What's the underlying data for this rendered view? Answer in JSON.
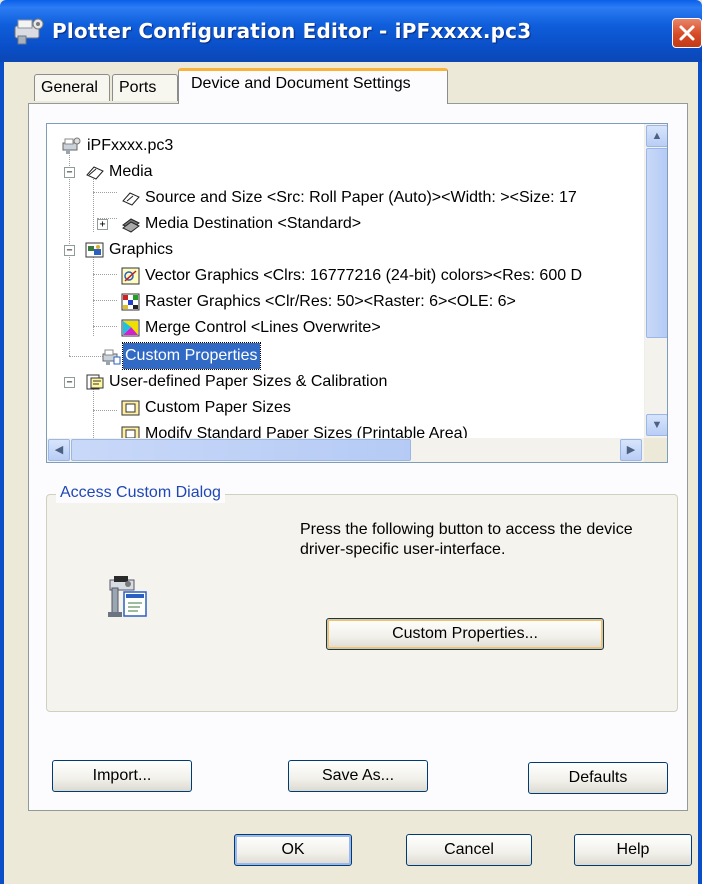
{
  "window": {
    "title": "Plotter Configuration Editor - iPFxxxx.pc3",
    "title_icon": "plotter-config-icon",
    "close_icon": "close-x-icon"
  },
  "tabs": [
    {
      "label": "General",
      "active": false
    },
    {
      "label": "Ports",
      "active": false
    },
    {
      "label": "Device and Document Settings",
      "active": true
    }
  ],
  "tree": {
    "items": [
      {
        "label": "iPFxxxx.pc3",
        "icon": "plotter-icon",
        "expander": ""
      },
      {
        "label": "Media",
        "icon": "media-icon",
        "expander": "−"
      },
      {
        "label": "Source and Size <Src:  Roll Paper (Auto)><Width: ><Size: 17",
        "icon": "paper-source-icon",
        "expander": ""
      },
      {
        "label": "Media Destination <Standard>",
        "icon": "media-destination-icon",
        "expander": "+"
      },
      {
        "label": "Graphics",
        "icon": "graphics-icon",
        "expander": "−"
      },
      {
        "label": "Vector Graphics <Clrs: 16777216  (24-bit) colors><Res: 600 D",
        "icon": "vector-graphics-icon",
        "expander": ""
      },
      {
        "label": "Raster Graphics <Clr/Res: 50><Raster: 6><OLE: 6>",
        "icon": "raster-graphics-icon",
        "expander": ""
      },
      {
        "label": "Merge Control <Lines Overwrite>",
        "icon": "merge-control-icon",
        "expander": ""
      },
      {
        "label": "Custom Properties",
        "icon": "custom-properties-icon",
        "expander": "",
        "selected": true
      },
      {
        "label": "User-defined Paper Sizes & Calibration",
        "icon": "paper-sizes-icon",
        "expander": "−"
      },
      {
        "label": "Custom Paper Sizes",
        "icon": "custom-paper-icon",
        "expander": ""
      },
      {
        "label": "Modify Standard Paper Sizes (Printable Area)",
        "icon": "modify-paper-icon",
        "expander": ""
      }
    ]
  },
  "scrollbars": {
    "up_icon": "scroll-up-icon",
    "down_icon": "scroll-down-icon",
    "left_icon": "scroll-left-icon",
    "right_icon": "scroll-right-icon"
  },
  "group": {
    "legend": "Access Custom Dialog",
    "description": "Press the following button to access the device driver-specific user-interface.",
    "button_label": "Custom Properties...",
    "icon": "printer-dialog-icon"
  },
  "buttons": {
    "import": "Import...",
    "save_as": "Save As...",
    "defaults": "Defaults",
    "ok": "OK",
    "cancel": "Cancel",
    "help": "Help"
  },
  "colors": {
    "titlebar": "#0A4FC8",
    "selection": "#316AC5",
    "group_legend": "#1F47B5",
    "focus_ring": "#F5C06A"
  }
}
